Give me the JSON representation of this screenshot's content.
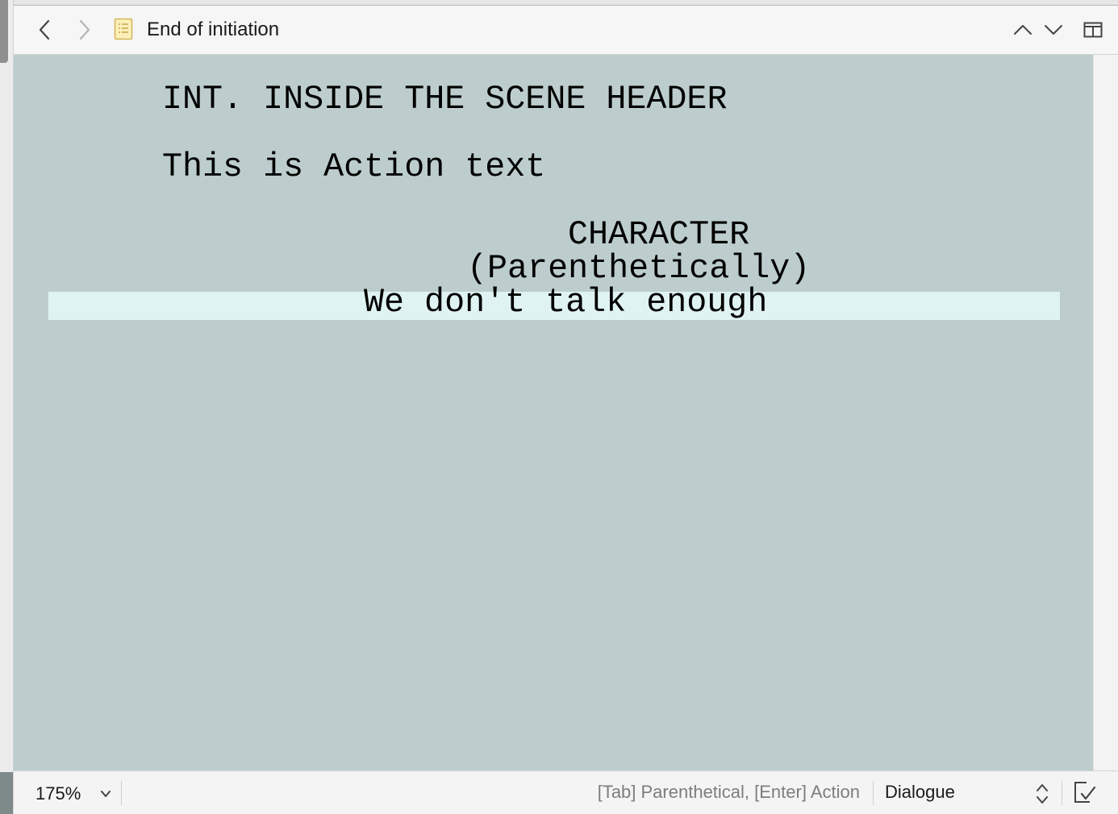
{
  "header": {
    "doc_title": "End of initiation",
    "doc_icon": "document-outline-icon",
    "back_icon": "chevron-left-icon",
    "forward_icon": "chevron-right-icon",
    "prev_icon": "chevron-up-icon",
    "next_icon": "chevron-down-icon",
    "split_icon": "split-editor-icon"
  },
  "script": {
    "scene_heading": "INT. INSIDE THE SCENE HEADER",
    "action": "This is Action text",
    "character": "CHARACTER",
    "parenthetical": "(Parenthetically)",
    "dialogue": "We don't talk enough"
  },
  "footer": {
    "zoom": "175%",
    "hint": "[Tab] Parenthetical, [Enter] Action",
    "element_type": "Dialogue",
    "done_icon": "checkmark-icon"
  },
  "colors": {
    "page_background": "#bdcdcd",
    "current_line_highlight": "#e0f3f3"
  }
}
